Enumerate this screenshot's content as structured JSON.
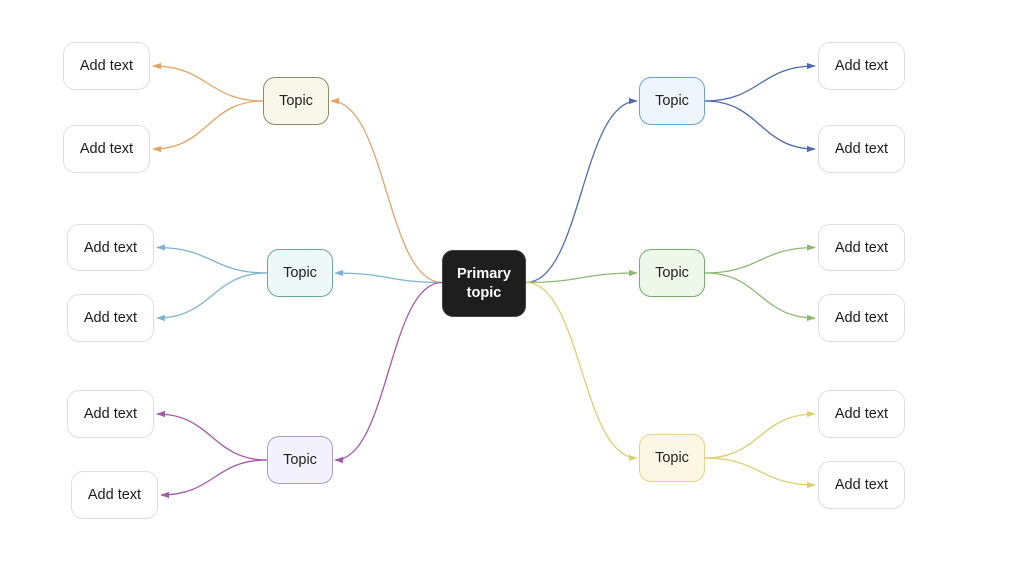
{
  "primary": {
    "label": "Primary topic",
    "line1": "Primary",
    "line2": "topic"
  },
  "branches": [
    {
      "id": "top-left",
      "side": "left",
      "label": "Topic",
      "color": "#e0a565",
      "fill": "#f8f8ea",
      "border": "#8c8c6a",
      "children": [
        {
          "label": "Add text"
        },
        {
          "label": "Add text"
        }
      ]
    },
    {
      "id": "middle-left",
      "side": "left",
      "label": "Topic",
      "color": "#7fb3cf",
      "fill": "#eef8f6",
      "border": "#6aa896",
      "children": [
        {
          "label": "Add text"
        },
        {
          "label": "Add text"
        }
      ]
    },
    {
      "id": "bottom-left",
      "side": "left",
      "label": "Topic",
      "color": "#a35aa6",
      "fill": "#f3f1fb",
      "border": "#a79ad6",
      "children": [
        {
          "label": "Add text"
        },
        {
          "label": "Add text"
        }
      ]
    },
    {
      "id": "top-right",
      "side": "right",
      "label": "Topic",
      "color": "#4f6bb0",
      "fill": "#eef5fd",
      "border": "#6ea2d3",
      "children": [
        {
          "label": "Add text"
        },
        {
          "label": "Add text"
        }
      ]
    },
    {
      "id": "middle-right",
      "side": "right",
      "label": "Topic",
      "color": "#8db872",
      "fill": "#eef8ea",
      "border": "#78ad6c",
      "children": [
        {
          "label": "Add text"
        },
        {
          "label": "Add text"
        }
      ]
    },
    {
      "id": "bottom-right",
      "side": "right",
      "label": "Topic",
      "color": "#dccf6e",
      "fill": "#fdf7e6",
      "border": "#eccf8a",
      "children": [
        {
          "label": "Add text"
        },
        {
          "label": "Add text"
        }
      ]
    }
  ]
}
